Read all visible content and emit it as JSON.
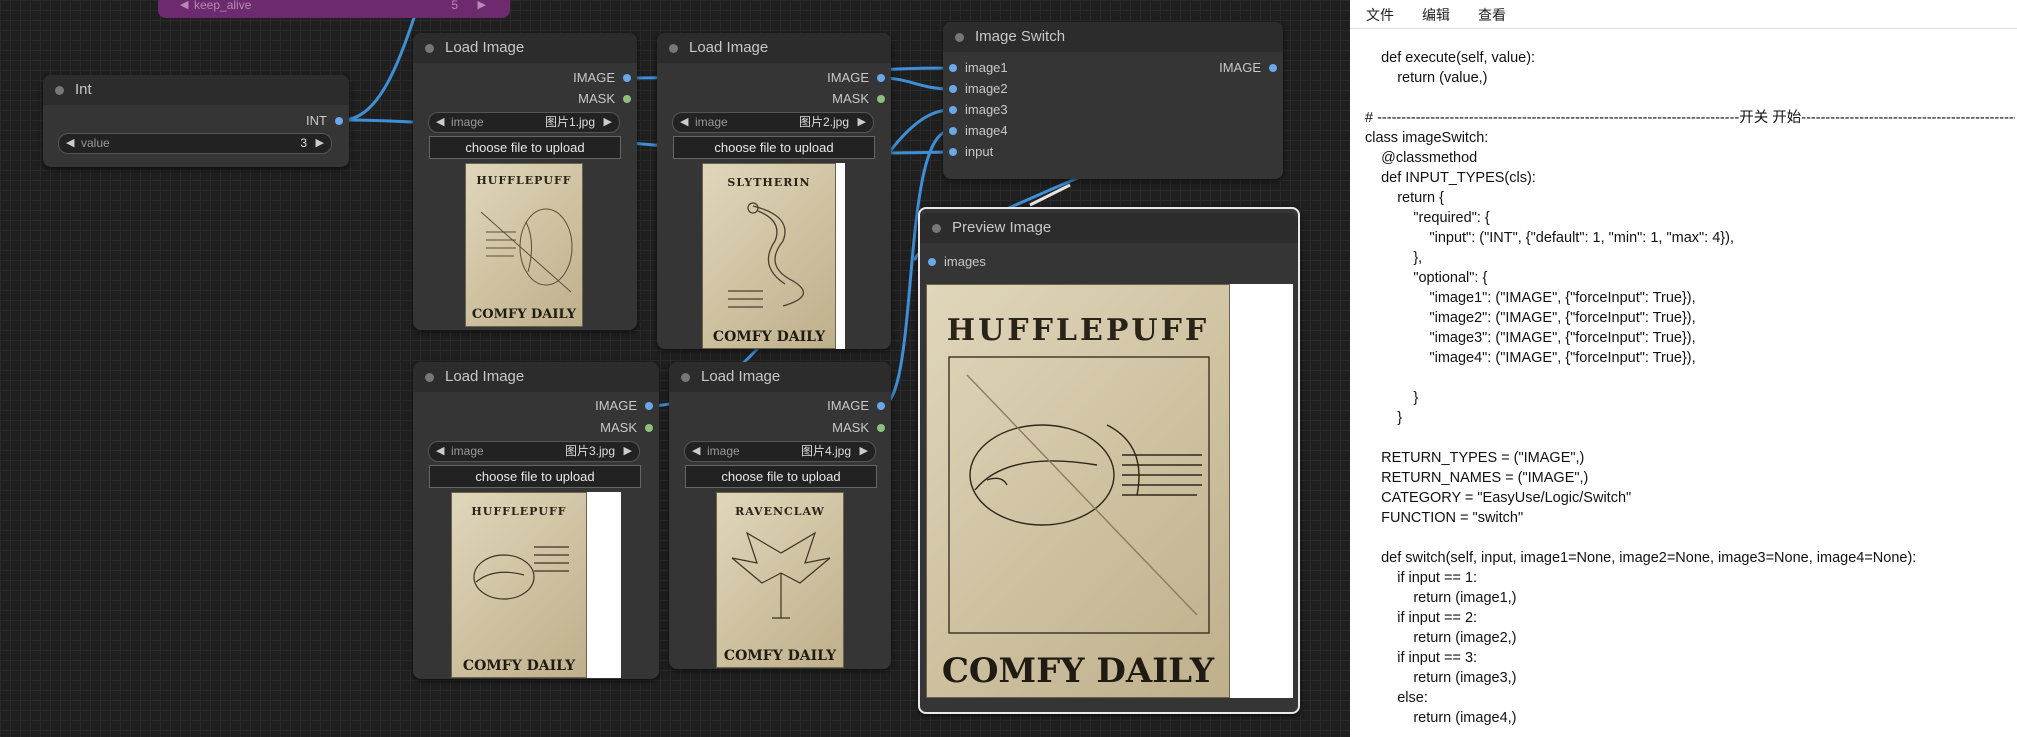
{
  "canvas": {
    "top_node": {
      "label": "keep_alive",
      "value": "5"
    },
    "int_node": {
      "title": "Int",
      "output": "INT",
      "widget": {
        "label": "value",
        "value": "3"
      }
    },
    "load_image_nodes": [
      {
        "title": "Load Image",
        "outputs": [
          "IMAGE",
          "MASK"
        ],
        "widget": {
          "label": "image",
          "value": "图片1.jpg"
        },
        "upload_label": "choose file to upload",
        "poster": {
          "header": "HUFFLEPUFF",
          "footer": "COMFY DAILY"
        }
      },
      {
        "title": "Load Image",
        "outputs": [
          "IMAGE",
          "MASK"
        ],
        "widget": {
          "label": "image",
          "value": "图片2.jpg"
        },
        "upload_label": "choose file to upload",
        "poster": {
          "header": "SLYTHERIN",
          "footer": "COMFY DAILY"
        }
      },
      {
        "title": "Load Image",
        "outputs": [
          "IMAGE",
          "MASK"
        ],
        "widget": {
          "label": "image",
          "value": "图片3.jpg"
        },
        "upload_label": "choose file to upload",
        "poster": {
          "header": "HUFFLEPUFF",
          "footer": "COMFY DAILY"
        }
      },
      {
        "title": "Load Image",
        "outputs": [
          "IMAGE",
          "MASK"
        ],
        "widget": {
          "label": "image",
          "value": "图片4.jpg"
        },
        "upload_label": "choose file to upload",
        "poster": {
          "header": "RAVENCLAW",
          "footer": "COMFY DAILY"
        }
      }
    ],
    "switch_node": {
      "title": "Image Switch",
      "inputs": [
        "image1",
        "image2",
        "image3",
        "image4",
        "input"
      ],
      "output": "IMAGE"
    },
    "preview_node": {
      "title": "Preview Image",
      "input": "images",
      "poster": {
        "header": "HUFFLEPUFF",
        "footer": "COMFY DAILY"
      }
    }
  },
  "editor": {
    "menu": [
      "文件",
      "编辑",
      "查看"
    ],
    "code_lines": [
      "    def execute(self, value):",
      "        return (value,)",
      "",
      "# ---------------------------------------------------------------------------开关 开始----------------------------------------------",
      "class imageSwitch:",
      "    @classmethod",
      "    def INPUT_TYPES(cls):",
      "        return {",
      "            \"required\": {",
      "                \"input\": (\"INT\", {\"default\": 1, \"min\": 1, \"max\": 4}),",
      "            },",
      "            \"optional\": {",
      "                \"image1\": (\"IMAGE\", {\"forceInput\": True}),",
      "                \"image2\": (\"IMAGE\", {\"forceInput\": True}),",
      "                \"image3\": (\"IMAGE\", {\"forceInput\": True}),",
      "                \"image4\": (\"IMAGE\", {\"forceInput\": True}),",
      "",
      "            }",
      "        }",
      "",
      "    RETURN_TYPES = (\"IMAGE\",)",
      "    RETURN_NAMES = (\"IMAGE\",)",
      "    CATEGORY = \"EasyUse/Logic/Switch\"",
      "    FUNCTION = \"switch\"",
      "",
      "    def switch(self, input, image1=None, image2=None, image3=None, image4=None):",
      "        if input == 1:",
      "            return (image1,)",
      "        if input == 2:",
      "            return (image2,)",
      "        if input == 3:",
      "            return (image3,)",
      "        else:",
      "            return (image4,)"
    ]
  },
  "colors": {
    "wire": "#3d8fd6",
    "node_bg": "#353535",
    "top_node": "#7a2a7a"
  }
}
